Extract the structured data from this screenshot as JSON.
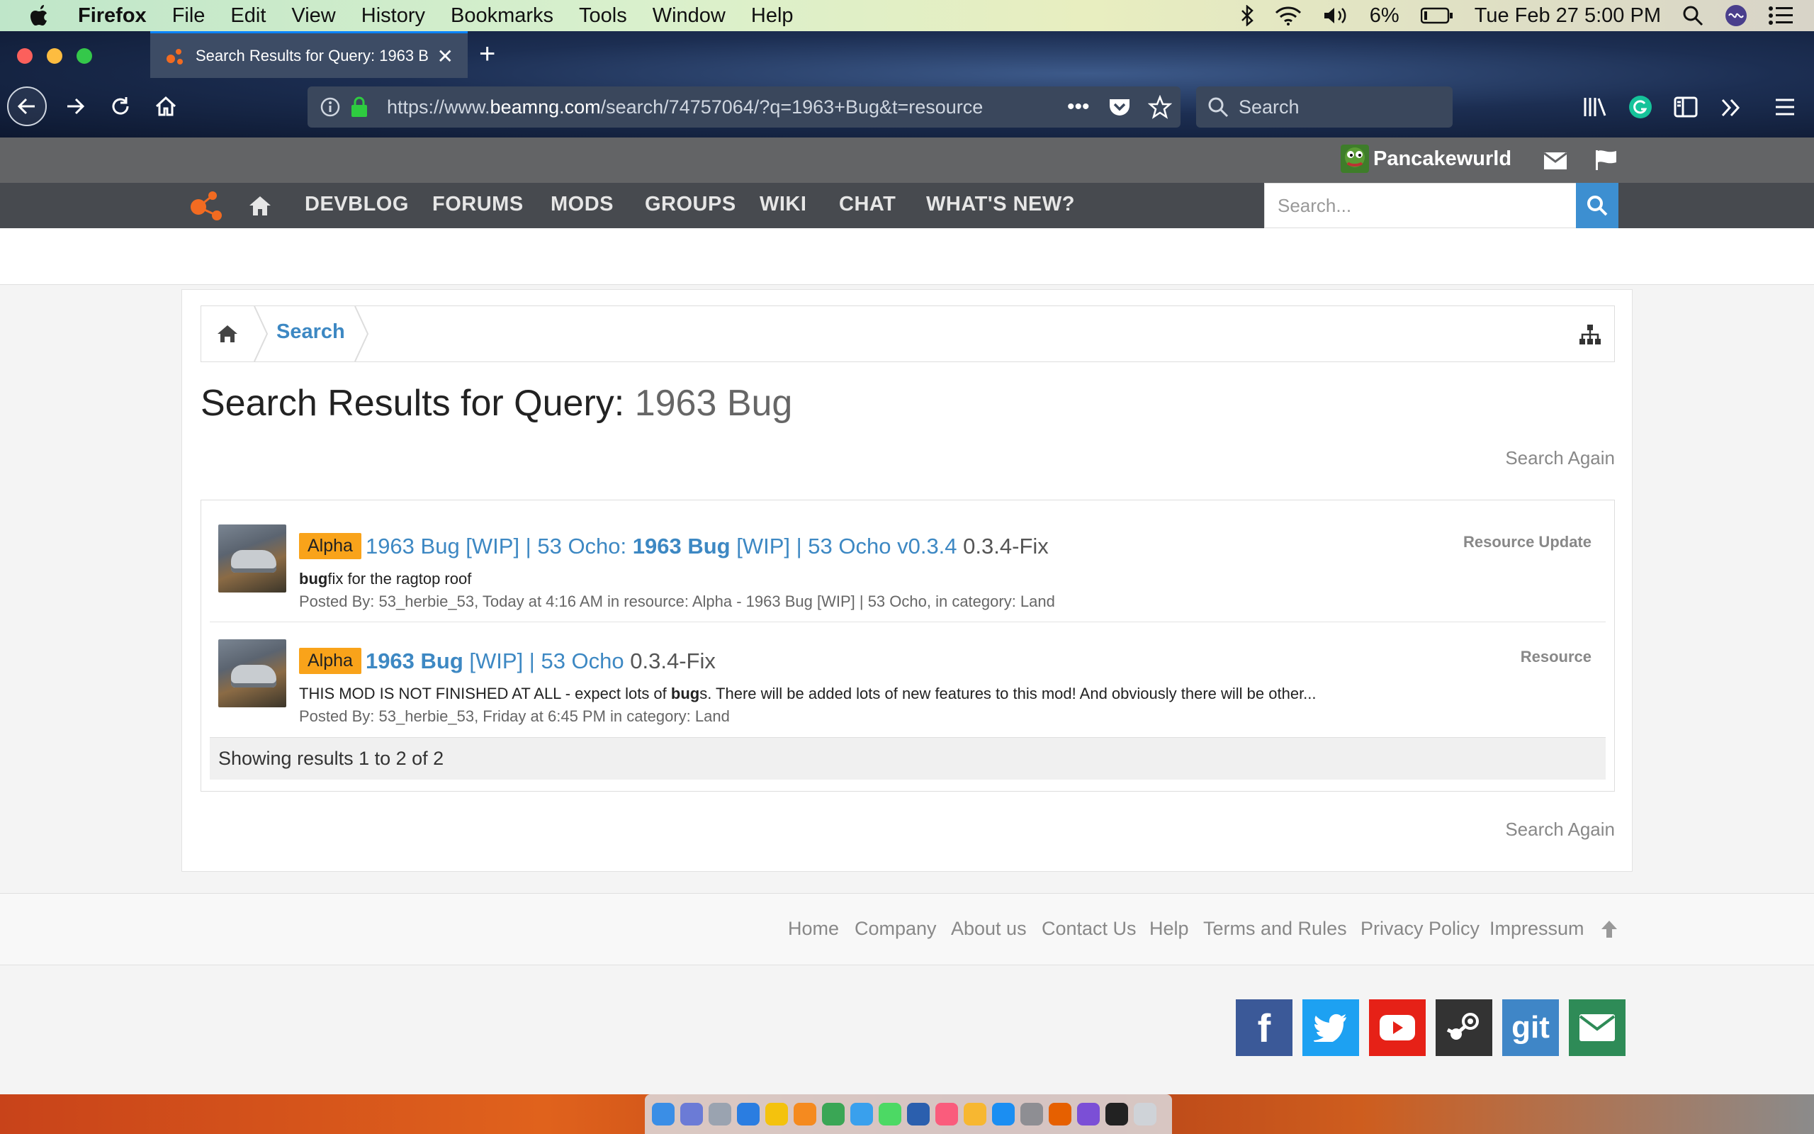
{
  "menubar": {
    "app": "Firefox",
    "items": [
      "File",
      "Edit",
      "View",
      "History",
      "Bookmarks",
      "Tools",
      "Window",
      "Help"
    ],
    "battery": "6%",
    "datetime": "Tue Feb 27  5:00 PM"
  },
  "browser": {
    "tab_title": "Search Results for Query: 1963 Bug",
    "url_prefix": "https://www.",
    "url_domain": "beamng.com",
    "url_suffix": "/search/74757064/?q=1963+Bug&t=resource",
    "search_placeholder": "Search"
  },
  "site": {
    "username": "Pancakewurld",
    "nav": [
      "DEVBLOG",
      "FORUMS",
      "MODS",
      "GROUPS",
      "WIKI",
      "CHAT",
      "WHAT'S NEW?"
    ],
    "search_placeholder": "Search..."
  },
  "breadcrumb": {
    "current": "Search"
  },
  "title": {
    "prefix": "Search Results for Query: ",
    "query": "1963 Bug"
  },
  "search_again": "Search Again",
  "results": [
    {
      "prefix": "Alpha",
      "title_a": "1963 Bug [WIP] | 53 Ocho: ",
      "title_b_bold": "1963 Bug",
      "title_c": " [WIP] | 53 Ocho v0.3.4",
      "version": "0.3.4-Fix",
      "snippet_bold": "bug",
      "snippet_rest": "fix for the ragtop roof",
      "meta": "Posted By: 53_herbie_53, Today at 4:16 AM in resource: Alpha - 1963 Bug [WIP] | 53 Ocho, in category: Land",
      "type": "Resource Update"
    },
    {
      "prefix": "Alpha",
      "title_a": "",
      "title_b_bold": "1963 Bug",
      "title_c": " [WIP] | 53 Ocho",
      "version": "0.3.4-Fix",
      "snippet_pre": "THIS MOD IS NOT FINISHED AT ALL - expect lots of ",
      "snippet_bold": "bug",
      "snippet_rest": "s. There will be added lots of new features to this mod! And obviously there will be other...",
      "meta": "Posted By: 53_herbie_53, Friday at 6:45 PM in category: Land",
      "type": "Resource"
    }
  ],
  "results_summary": "Showing results 1 to 2 of 2",
  "footer": [
    "Home",
    "Company",
    "About us",
    "Contact Us",
    "Help",
    "Terms and Rules",
    "Privacy Policy",
    "Impressum"
  ],
  "social": [
    {
      "name": "facebook",
      "label": "f",
      "color": "#3b5998"
    },
    {
      "name": "twitter",
      "label": "",
      "color": "#1da1f2"
    },
    {
      "name": "youtube",
      "label": "",
      "color": "#e62117"
    },
    {
      "name": "steam",
      "label": "",
      "color": "#333333"
    },
    {
      "name": "git",
      "label": "git",
      "color": "#3f86c7"
    },
    {
      "name": "email",
      "label": "",
      "color": "#2e8b57"
    }
  ]
}
